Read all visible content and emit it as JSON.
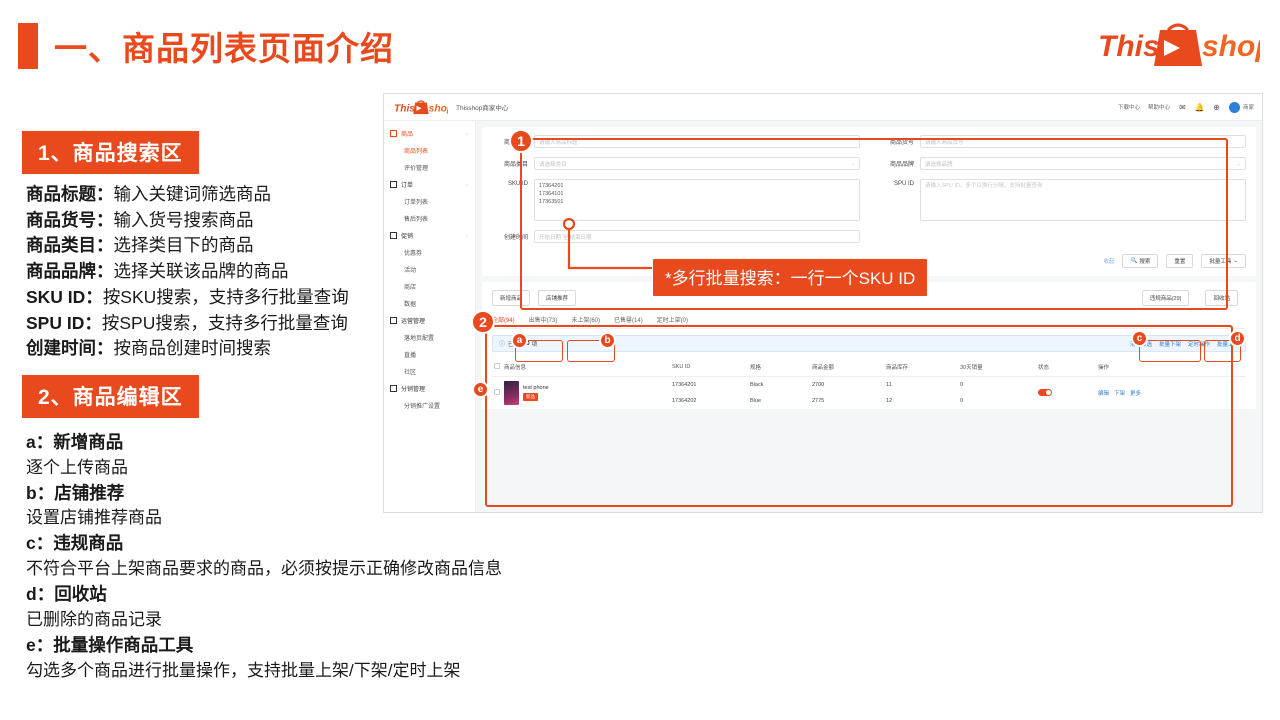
{
  "slide": {
    "title": "一、商品列表页面介绍",
    "brand": {
      "word1": "This",
      "word2": "shop"
    }
  },
  "sections": [
    {
      "heading": "1、商品搜索区",
      "lines": [
        {
          "label": "商品标题：",
          "text": "输入关键词筛选商品"
        },
        {
          "label": "商品货号：",
          "text": "输入货号搜索商品"
        },
        {
          "label": "商品类目：",
          "text": "选择类目下的商品"
        },
        {
          "label": "商品品牌：",
          "text": "选择关联该品牌的商品"
        },
        {
          "label": "SKU ID：",
          "text": "按SKU搜索，支持多行批量查询"
        },
        {
          "label": "SPU ID：",
          "text": "按SPU搜索，支持多行批量查询"
        },
        {
          "label": "创建时间：",
          "text": "按商品创建时间搜索"
        }
      ]
    },
    {
      "heading": "2、商品编辑区",
      "lines": [
        {
          "label": "a：新增商品",
          "text": ""
        },
        {
          "label": "",
          "text": "逐个上传商品"
        },
        {
          "label": "b：店铺推荐",
          "text": ""
        },
        {
          "label": "",
          "text": "设置店铺推荐商品"
        },
        {
          "label": "c：违规商品",
          "text": ""
        },
        {
          "label": "",
          "text": "不符合平台上架商品要求的商品，必须按提示正确修改商品信息"
        },
        {
          "label": "d：回收站",
          "text": ""
        },
        {
          "label": "",
          "text": "已删除的商品记录"
        },
        {
          "label": "e：批量操作商品工具",
          "text": ""
        },
        {
          "label": "",
          "text": "勾选多个商品进行批量操作，支持批量上架/下架/定时上架"
        }
      ]
    }
  ],
  "callout": "*多行批量搜索：一行一个SKU ID",
  "annotations": {
    "numbers": [
      "1",
      "2"
    ],
    "letters": [
      "a",
      "b",
      "c",
      "d",
      "e"
    ]
  },
  "screenshot": {
    "header": {
      "logo_word1": "This",
      "logo_word2": "shop",
      "center_title": "Thisshop商家中心",
      "nav": [
        {
          "label": "下载中心",
          "icon": "download-center-icon"
        },
        {
          "label": "帮助中心",
          "icon": "help-center-icon"
        }
      ],
      "icons": [
        "message-icon",
        "bell-icon",
        "globe-icon"
      ],
      "user_label": "商家"
    },
    "sidebar": [
      {
        "type": "group",
        "label": "商品",
        "icon": "goods-icon",
        "active": true
      },
      {
        "type": "item",
        "label": "商品列表",
        "active": true
      },
      {
        "type": "item",
        "label": "评价管理",
        "active": false
      },
      {
        "type": "group",
        "label": "订单",
        "icon": "order-icon",
        "active": false
      },
      {
        "type": "item",
        "label": "订单列表",
        "active": false
      },
      {
        "type": "item",
        "label": "售后列表",
        "active": false
      },
      {
        "type": "group",
        "label": "促销",
        "icon": "promo-icon",
        "active": false
      },
      {
        "type": "item",
        "label": "优惠券",
        "active": false
      },
      {
        "type": "item",
        "label": "活动",
        "active": false
      },
      {
        "type": "item",
        "label": "商店",
        "active": false
      },
      {
        "type": "item",
        "label": "数据",
        "active": false
      },
      {
        "type": "group",
        "label": "运营管理",
        "icon": "operation-icon",
        "active": false
      },
      {
        "type": "item",
        "label": "落地页配置",
        "active": false
      },
      {
        "type": "item",
        "label": "直播",
        "active": false
      },
      {
        "type": "item",
        "label": "社区",
        "active": false
      },
      {
        "type": "group",
        "label": "分销管理",
        "icon": "distribution-icon",
        "active": false
      },
      {
        "type": "item",
        "label": "分销推广设置",
        "active": false
      }
    ],
    "search_form": {
      "left": [
        {
          "label": "商品标题",
          "placeholder": "请输入商品标题",
          "type": "input"
        },
        {
          "label": "商品类目",
          "placeholder": "请选择类目",
          "type": "select"
        },
        {
          "label": "SKU ID",
          "value": "17364201\n17364101\n17363501",
          "type": "textarea"
        },
        {
          "label": "创建时间",
          "placeholder": "开始日期 至 结束日期",
          "type": "date"
        }
      ],
      "right": [
        {
          "label": "商品货号",
          "placeholder": "请输入商品货号",
          "type": "input"
        },
        {
          "label": "商品品牌",
          "placeholder": "请选择品牌",
          "type": "select"
        },
        {
          "label": "SPU ID",
          "placeholder": "请输入SPU ID，多个以换行分隔，支持批量查询",
          "type": "textarea"
        }
      ],
      "buttons": {
        "expand": "收起",
        "search": "搜索",
        "reset": "重置",
        "bulk_tools": "批量工具"
      }
    },
    "toolbar": {
      "add_product": "新增商品",
      "shop_recommend": "店铺推荐",
      "violation_products": "违规商品(29)",
      "recycle_bin": "回收站"
    },
    "tabs": [
      {
        "label": "全部(94)",
        "active": true
      },
      {
        "label": "出售中(73)",
        "active": false
      },
      {
        "label": "未上架(60)",
        "active": false
      },
      {
        "label": "已售罄(14)",
        "active": false
      },
      {
        "label": "定时上架(0)",
        "active": false
      }
    ],
    "select_bar": {
      "prefix": "已选择",
      "count": "0",
      "suffix": "项",
      "actions": [
        "清空筛选",
        "批量下架",
        "定时操作",
        "批量上架"
      ]
    },
    "table": {
      "headers": [
        "商品信息",
        "SKU ID",
        "规格",
        "商品金额",
        "商品库存",
        "30天销量",
        "状态",
        "操作"
      ],
      "rows": [
        {
          "product": "test phone",
          "tag": "新品",
          "skus": [
            {
              "sku_id": "17364201",
              "spec": "Black",
              "amount": "2700",
              "stock": "11",
              "sales_30d": "0"
            },
            {
              "sku_id": "17364202",
              "spec": "Blue",
              "amount": "2775",
              "stock": "12",
              "sales_30d": "0"
            }
          ],
          "status_on": true,
          "ops": [
            "编辑",
            "下架",
            "更多"
          ]
        }
      ]
    }
  },
  "colors": {
    "accent": "#E8491D",
    "link": "#2b7fd4",
    "panel_bg": "#f5f6f8"
  }
}
